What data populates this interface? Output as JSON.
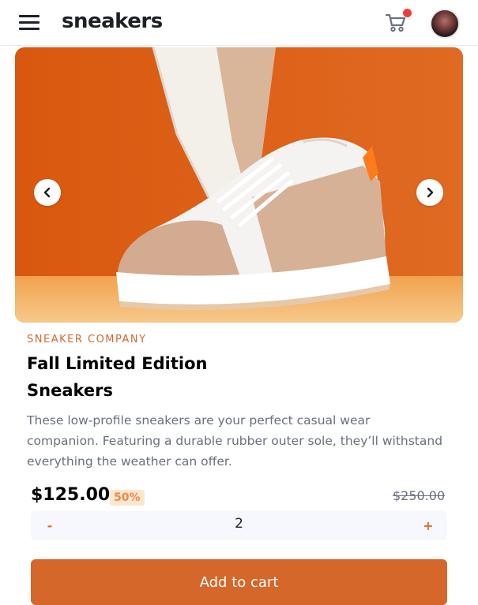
{
  "header": {
    "menu_icon": "hamburger-menu-icon",
    "logo": "sneakers",
    "cart_icon": "cart-icon",
    "cart_badge_color": "#ef3d3d"
  },
  "gallery": {
    "prev_icon": "chevron-left-icon",
    "next_icon": "chevron-right-icon",
    "image": "sneaker-product-image"
  },
  "product": {
    "company": "SNEAKER COMPANY",
    "title_line1": "Fall Limited Edition",
    "title_line2": "Sneakers",
    "description": "These low-profile sneakers are your perfect casual wear companion. Featuring a durable rubber outer sole, they’ll withstand everything the weather can offer.",
    "price": "$125.00",
    "discount": "50%",
    "old_price": "$250.00"
  },
  "quantity": {
    "minus_label": "-",
    "value": "2",
    "plus_label": "+"
  },
  "cta": {
    "add_to_cart_label": "Add to cart"
  },
  "colors": {
    "accent": "#d5672a",
    "text_dark": "#1d2026",
    "text_muted": "#68707d",
    "discount_bg": "#fde7cf"
  }
}
